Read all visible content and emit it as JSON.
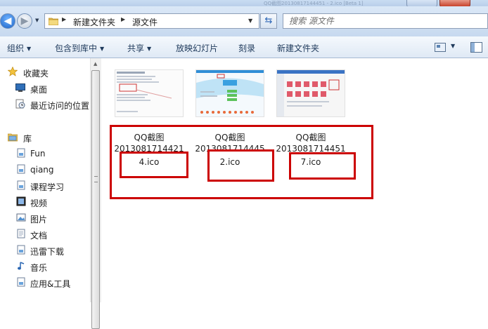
{
  "window": {
    "ghost_title": "QQ截图20130817144451 - 2.ico [Beta 1]"
  },
  "nav": {
    "breadcrumbs": [
      "新建文件夹",
      "源文件"
    ],
    "search_placeholder": "搜索 源文件",
    "back_icon": "back-arrow-icon",
    "forward_icon": "forward-arrow-icon",
    "refresh_icon": "refresh-icon"
  },
  "toolbar": {
    "organize": "组织",
    "include_in_library": "包含到库中",
    "share": "共享",
    "slideshow": "放映幻灯片",
    "burn": "刻录",
    "new_folder": "新建文件夹"
  },
  "sidebar": {
    "favorites": {
      "header": "收藏夹",
      "items": [
        "桌面",
        "最近访问的位置"
      ]
    },
    "libraries": {
      "header": "库",
      "items": [
        "Fun",
        "qiang",
        "课程学习",
        "视频",
        "图片",
        "文档",
        "迅雷下载",
        "音乐",
        "应用&工具"
      ]
    }
  },
  "files": [
    {
      "name_line1": "QQ截图",
      "name_line2": "2013081714421",
      "name_line3": "4.ico"
    },
    {
      "name_line1": "QQ截图",
      "name_line2": "2013081714445",
      "name_line3": "2.ico"
    },
    {
      "name_line1": "QQ截图",
      "name_line2": "2013081714451",
      "name_line3": "7.ico"
    }
  ],
  "colors": {
    "annotation_red": "#cc0000",
    "toolbar_text": "#1e395b",
    "chrome_blue": "#c7d9ef"
  }
}
